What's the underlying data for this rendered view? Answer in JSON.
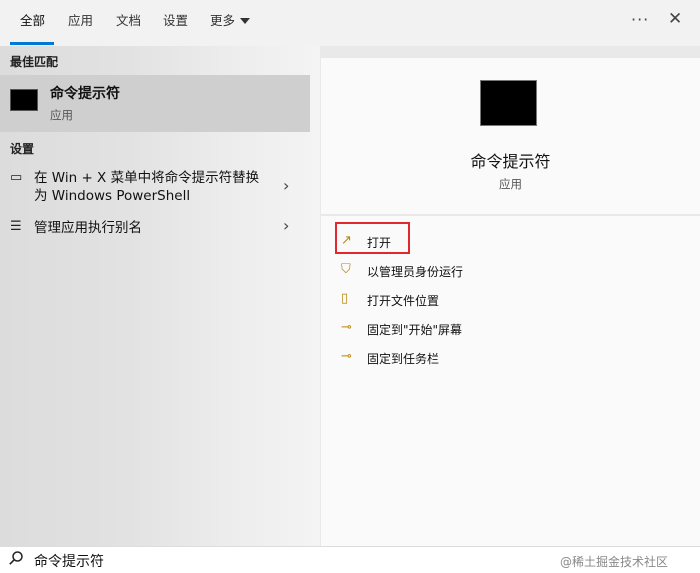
{
  "tabs": [
    {
      "label": "全部",
      "active": true
    },
    {
      "label": "应用",
      "active": false
    },
    {
      "label": "文档",
      "active": false
    },
    {
      "label": "设置",
      "active": false
    }
  ],
  "tab_more_label": "更多",
  "top_actions": {
    "more_options_glyph": "···",
    "close_glyph": "✕"
  },
  "left": {
    "best_match_heading": "最佳匹配",
    "best_match": {
      "title": "命令提示符",
      "subtitle": "应用",
      "icon": "command-prompt-icon"
    },
    "settings_heading": "设置",
    "settings_items": [
      {
        "text": "在 Win + X 菜单中将命令提示符替换为 Windows PowerShell",
        "icon": "monitor-icon"
      },
      {
        "text": "管理应用执行别名",
        "icon": "list-icon"
      }
    ]
  },
  "right": {
    "app_title": "命令提示符",
    "app_subtitle": "应用",
    "actions": [
      {
        "label": "打开",
        "icon": "open-icon",
        "highlighted": true
      },
      {
        "label": "以管理员身份运行",
        "icon": "shield-icon",
        "highlighted": false
      },
      {
        "label": "打开文件位置",
        "icon": "folder-icon",
        "highlighted": false
      },
      {
        "label": "固定到\"开始\"屏幕",
        "icon": "pin-icon",
        "highlighted": false
      },
      {
        "label": "固定到任务栏",
        "icon": "pin-icon",
        "highlighted": false
      }
    ]
  },
  "search": {
    "value": "命令提示符"
  },
  "watermark": "@稀土掘金技术社区",
  "colors": {
    "accent": "#0078d4",
    "highlight_border": "#e0282e",
    "action_icon": "#b8860b"
  }
}
